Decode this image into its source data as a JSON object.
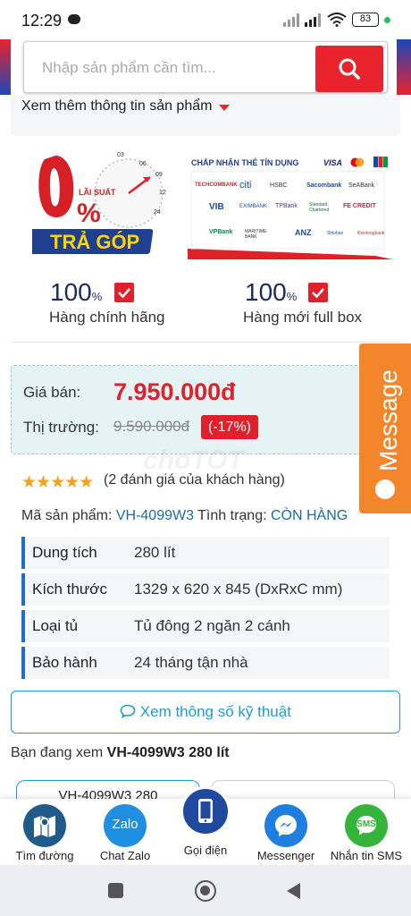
{
  "status_bar": {
    "time": "12:29",
    "battery": "83"
  },
  "search": {
    "placeholder": "Nhập sản phẩm cần tìm..."
  },
  "more_info": {
    "label": "Xem thêm thông tin sản phẩm"
  },
  "promo": {
    "rate_label": "LÃI SUẤT",
    "rate": "0%",
    "installment": "TRẢ GÓP",
    "dial_marks": [
      "03",
      "06",
      "09",
      "12",
      "24"
    ],
    "cards_heading": "CHẤP NHẬN THẺ TÍN DỤNG",
    "card_brands": [
      "VISA"
    ],
    "banks": [
      "TECHCOMBANK",
      "citi",
      "HSBC",
      "Sacombank",
      "SeABank",
      "VIB",
      "EXIMBANK",
      "TPBank",
      "Standard Chartered",
      "FE CREDIT",
      "VPBank",
      "MARITIME BANK",
      "ANZ",
      "Shinhan",
      "Kienlongbank"
    ]
  },
  "badges": [
    {
      "number": "100",
      "unit": "%",
      "caption": "Hàng chính hãng"
    },
    {
      "number": "100",
      "unit": "%",
      "caption": "Hàng mới full box"
    }
  ],
  "price": {
    "sale_label": "Giá bán:",
    "sale_value": "7.950.000đ",
    "market_label": "Thị trường:",
    "market_value": "9.590.000đ",
    "discount": "(-17%)"
  },
  "message_tab": {
    "label": "Message"
  },
  "watermark": "choTOT",
  "rating": {
    "stars": 5,
    "text": "(2 đánh giá của khách hàng)"
  },
  "product": {
    "sku_label": "Mã sản phẩm:",
    "sku": "VH-4099W3",
    "status_label": "Tình trạng:",
    "status": "CÒN HÀNG"
  },
  "specs": [
    {
      "key": "Dung tích",
      "value": "280 lít"
    },
    {
      "key": "Kích thước",
      "value": "1329 x 620 x 845 (DxRxC mm)"
    },
    {
      "key": "Loại tủ",
      "value": "Tủ đông 2 ngăn 2 cánh"
    },
    {
      "key": "Bảo hành",
      "value": "24 tháng tận nhà"
    }
  ],
  "specs_button": {
    "label": "Xem thông số kỹ thuật"
  },
  "viewing": {
    "prefix": "Bạn đang xem",
    "product": "VH-4099W3 280 lít"
  },
  "variants": [
    {
      "label": "VH-4099W3 280"
    },
    {
      "label": ""
    }
  ],
  "bottom_nav": [
    {
      "label": "Tìm đường",
      "icon": "map-icon",
      "color": "#1f5a8a"
    },
    {
      "label": "Chat Zalo",
      "icon": "zalo-icon",
      "color": "#1e8fe1",
      "icon_text": "Zalo"
    },
    {
      "label": "Gọi điện",
      "icon": "phone-icon",
      "color": "#1f4aa0"
    },
    {
      "label": "Messenger",
      "icon": "messenger-icon",
      "color": "#1f7fe0"
    },
    {
      "label": "Nhắn tin SMS",
      "icon": "sms-icon",
      "color": "#34b43a",
      "icon_text": "SMS"
    }
  ],
  "colors": {
    "brand_red": "#e0202a",
    "accent_blue": "#1f6fd0",
    "orange": "#f3852a"
  }
}
